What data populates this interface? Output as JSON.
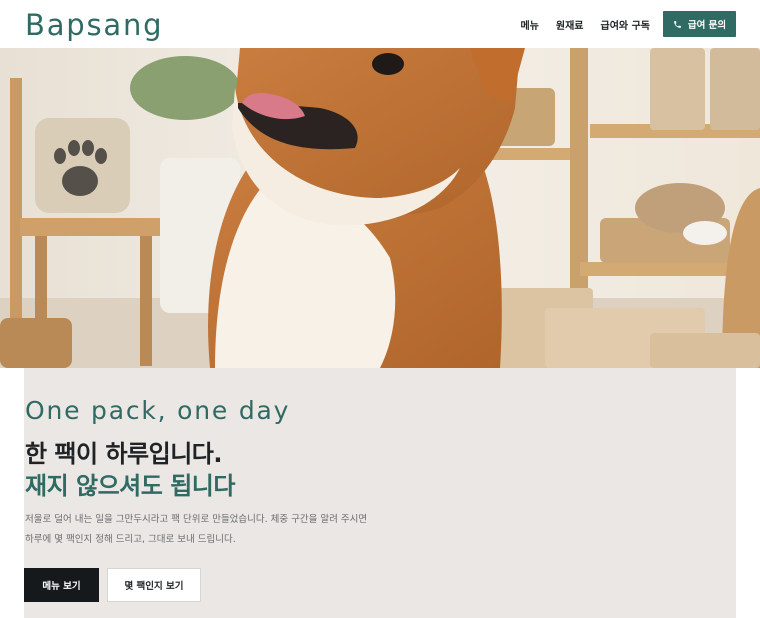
{
  "header": {
    "brand": "Bapsang",
    "nav": [
      {
        "label": "메뉴"
      },
      {
        "label": "원재료"
      },
      {
        "label": "급여와 구독"
      }
    ],
    "cta_label": "급여 문의",
    "cta_icon": "phone-icon"
  },
  "hero": {
    "image": "shiba-inu-dog-in-pet-shop-photo"
  },
  "content": {
    "eyebrow": "One pack, one day",
    "headline_line1": "한 팩이 하루입니다.",
    "headline_line2": "재지 않으셔도 됩니다",
    "description": "저울로 덜어 내는 일을 그만두시라고 팩 단위로 만들었습니다. 체중 구간을 알려 주시면 하루에 몇 팩인지 정해 드리고, 그대로 보내 드립니다.",
    "primary_button": "메뉴 보기",
    "secondary_button": "몇 팩인지 보기"
  },
  "colors": {
    "accent": "#2f6b63",
    "dark": "#15191c",
    "card_background": "#ebe7e4"
  }
}
